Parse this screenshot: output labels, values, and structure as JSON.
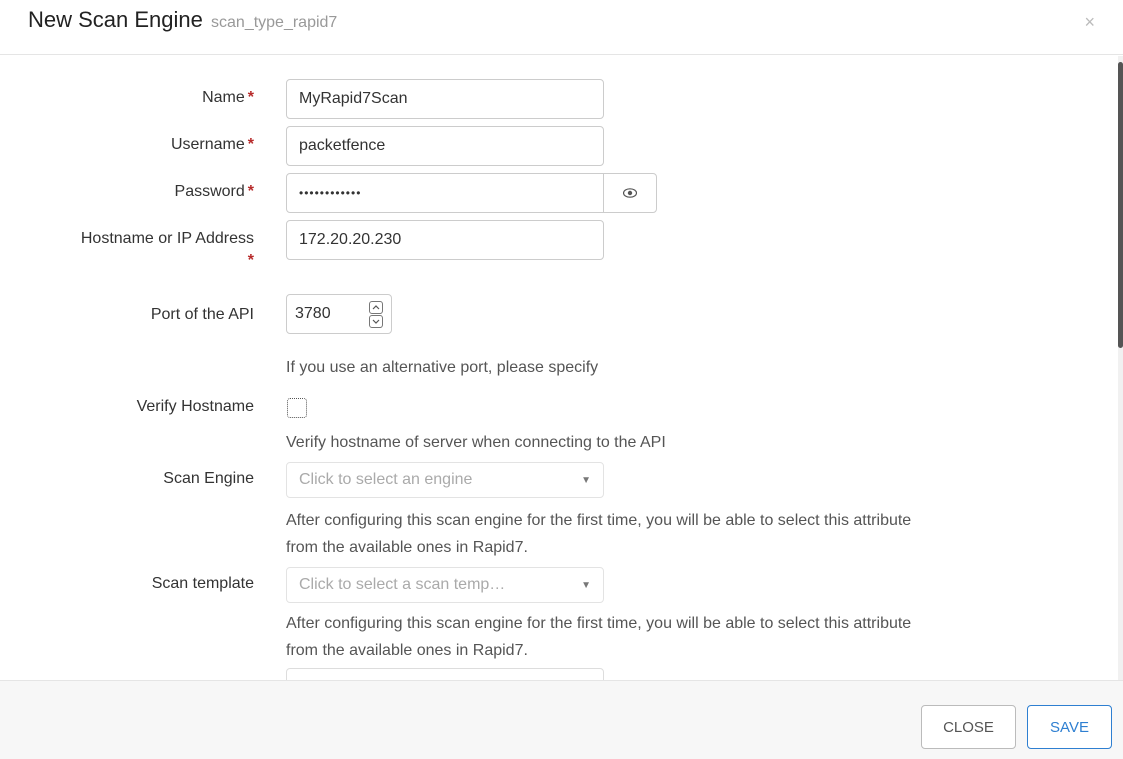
{
  "dialog": {
    "title": "New Scan Engine",
    "subtitle": "scan_type_rapid7",
    "close_icon": "×"
  },
  "form": {
    "required_mark": "*",
    "name": {
      "label": "Name",
      "value": "MyRapid7Scan"
    },
    "username": {
      "label": "Username",
      "value": "packetfence"
    },
    "password": {
      "label": "Password",
      "value": "••••••••••••",
      "toggle_icon": "eye-icon"
    },
    "hostname": {
      "label": "Hostname or IP Address",
      "value": "172.20.20.230"
    },
    "port": {
      "label": "Port of the API",
      "value": "3780",
      "help": "If you use an alternative port, please specify"
    },
    "verify_hostname": {
      "label": "Verify Hostname",
      "checked": false,
      "help": "Verify hostname of server when connecting to the API"
    },
    "scan_engine": {
      "label": "Scan Engine",
      "placeholder": "Click to select an engine",
      "help_line1": "After configuring this scan engine for the first time, you will be able to select this attribute",
      "help_line2": "from the available ones in Rapid7."
    },
    "scan_template": {
      "label": "Scan template",
      "placeholder": "Click to select a scan temp…",
      "help_line1": "After configuring this scan engine for the first time, you will be able to select this attribute",
      "help_line2": "from the available ones in Rapid7."
    }
  },
  "footer": {
    "close_label": "CLOSE",
    "save_label": "SAVE"
  }
}
